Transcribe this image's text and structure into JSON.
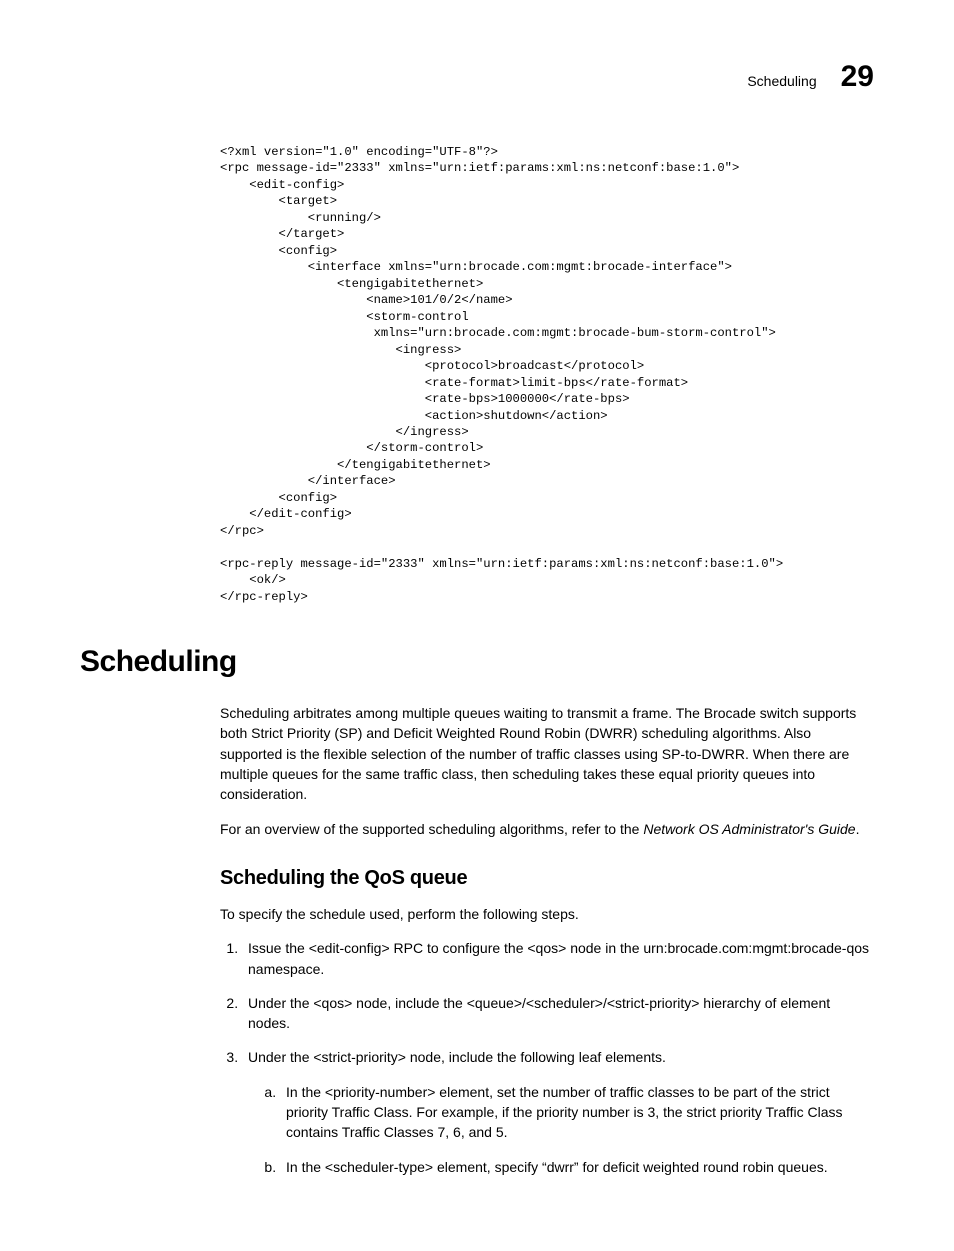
{
  "header": {
    "running_head": "Scheduling",
    "chapter_number": "29"
  },
  "code": "<?xml version=\"1.0\" encoding=\"UTF-8\"?>\n<rpc message-id=\"2333\" xmlns=\"urn:ietf:params:xml:ns:netconf:base:1.0\">\n    <edit-config>\n        <target>\n            <running/>\n        </target>\n        <config>\n            <interface xmlns=\"urn:brocade.com:mgmt:brocade-interface\">\n                <tengigabitethernet>\n                    <name>101/0/2</name>\n                    <storm-control\n                     xmlns=\"urn:brocade.com:mgmt:brocade-bum-storm-control\">\n                        <ingress>\n                            <protocol>broadcast</protocol>\n                            <rate-format>limit-bps</rate-format>\n                            <rate-bps>1000000</rate-bps>\n                            <action>shutdown</action>\n                        </ingress>\n                    </storm-control>\n                </tengigabitethernet>\n            </interface>\n        <config>\n    </edit-config>\n</rpc>\n\n<rpc-reply message-id=\"2333\" xmlns=\"urn:ietf:params:xml:ns:netconf:base:1.0\">\n    <ok/>\n</rpc-reply>",
  "section": {
    "title": "Scheduling",
    "para1": "Scheduling arbitrates among multiple queues waiting to transmit a frame. The Brocade switch supports both Strict Priority (SP) and Deficit Weighted Round Robin (DWRR) scheduling algorithms. Also supported is the flexible selection of the number of traffic classes using SP-to-DWRR. When there are multiple queues for the same traffic class, then scheduling takes these equal priority queues into consideration.",
    "para2_a": "For an overview of the supported scheduling algorithms, refer to the ",
    "para2_ref": "Network OS Administrator's Guide",
    "para2_b": "."
  },
  "subsection": {
    "title": "Scheduling the QoS queue",
    "intro": "To specify the schedule used, perform the following steps.",
    "steps": [
      "Issue the <edit-config> RPC to configure the <qos> node in the urn:brocade.com:mgmt:brocade-qos namespace.",
      "Under the <qos> node, include the <queue>/<scheduler>/<strict-priority> hierarchy of element nodes.",
      "Under the <strict-priority> node, include the following leaf elements."
    ],
    "substeps": [
      "In the <priority-number> element, set the number of traffic classes to be part of the strict priority Traffic Class. For example, if the priority number is 3, the strict priority Traffic Class contains Traffic Classes 7, 6, and 5.",
      "In the <scheduler-type> element, specify “dwrr” for deficit weighted round robin queues."
    ]
  }
}
